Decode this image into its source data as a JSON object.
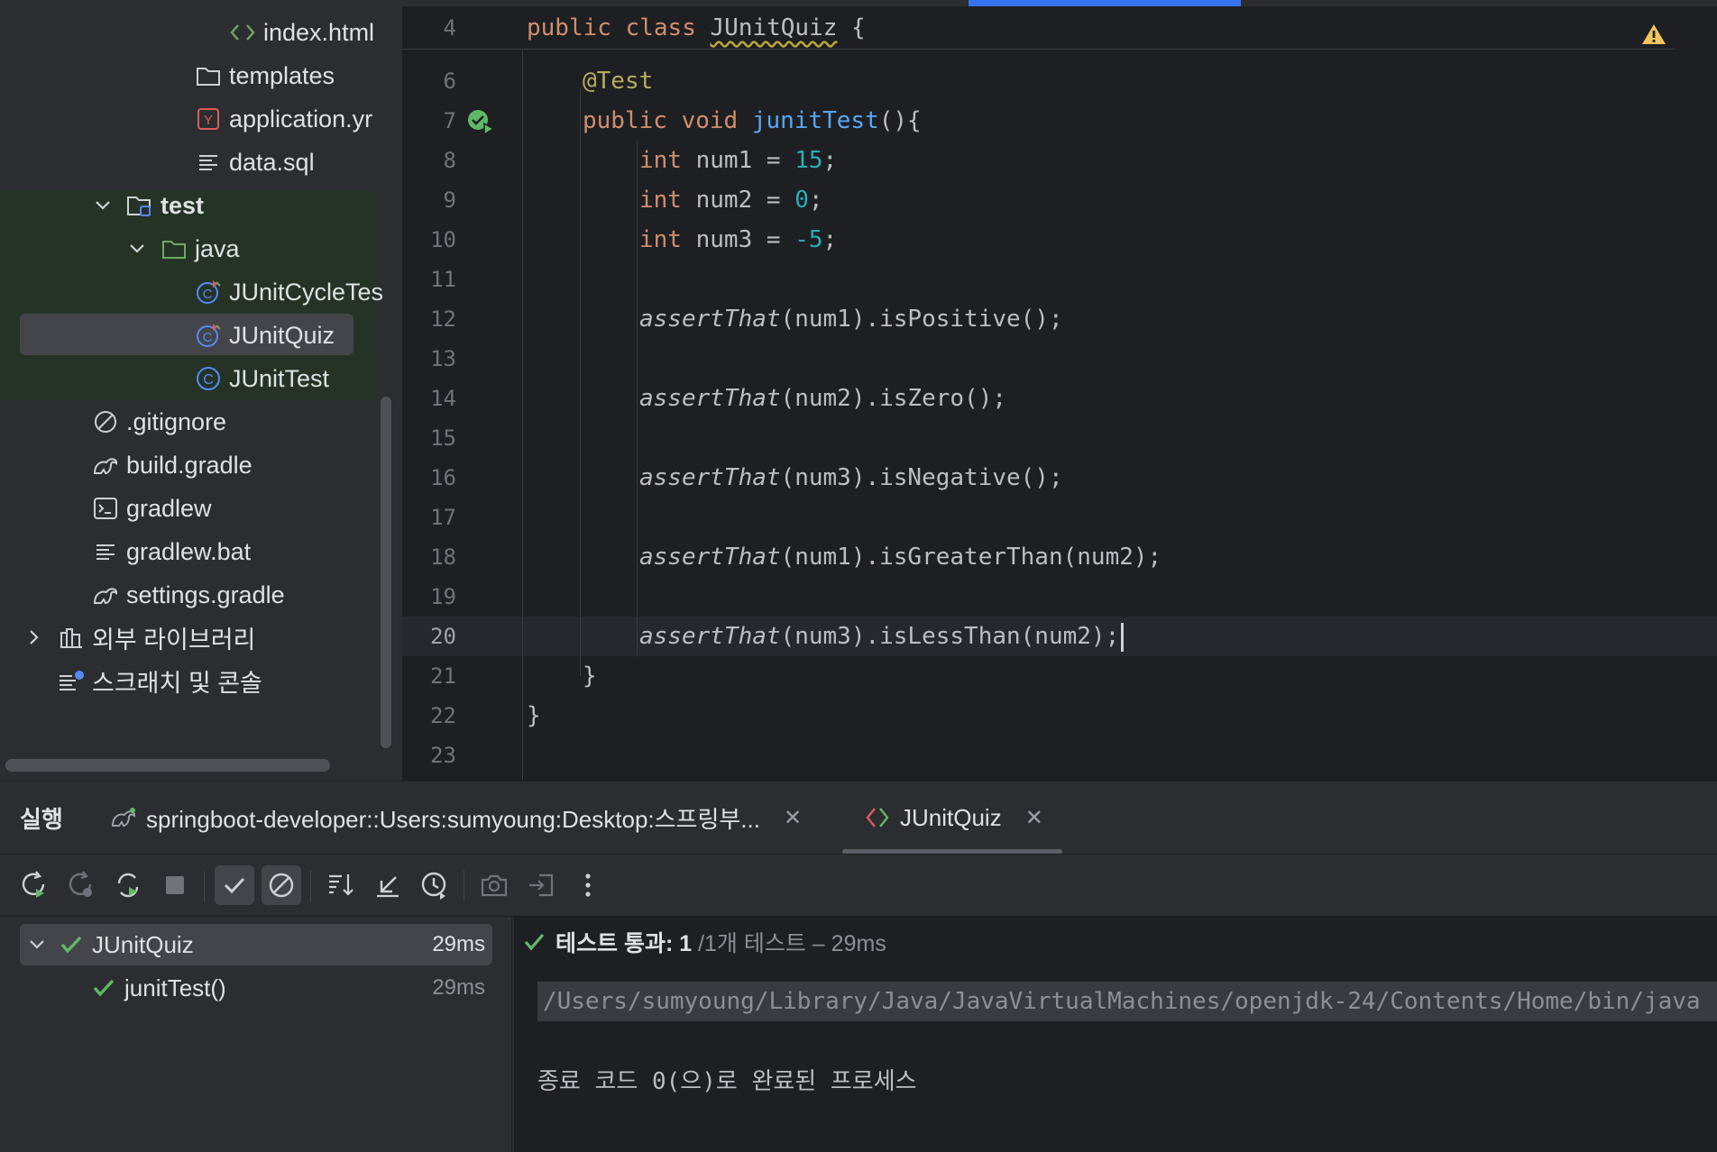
{
  "project_tree": {
    "items": [
      {
        "label": "index.html",
        "icon": "html-icon"
      },
      {
        "label": "templates",
        "icon": "folder-icon"
      },
      {
        "label": "application.yr",
        "icon": "yaml-icon"
      },
      {
        "label": "data.sql",
        "icon": "text-file-icon"
      },
      {
        "label": "test",
        "icon": "test-folder-icon"
      },
      {
        "label": "java",
        "icon": "folder-icon"
      },
      {
        "label": "JUnitCycleTes",
        "icon": "test-class-icon"
      },
      {
        "label": "JUnitQuiz",
        "icon": "test-class-icon"
      },
      {
        "label": "JUnitTest",
        "icon": "class-icon"
      },
      {
        "label": ".gitignore",
        "icon": "ignore-icon"
      },
      {
        "label": "build.gradle",
        "icon": "gradle-icon"
      },
      {
        "label": "gradlew",
        "icon": "terminal-file-icon"
      },
      {
        "label": "gradlew.bat",
        "icon": "text-file-icon"
      },
      {
        "label": "settings.gradle",
        "icon": "gradle-icon"
      },
      {
        "label": "외부 라이브러리",
        "icon": "library-icon"
      },
      {
        "label": "스크래치 및 콘솔",
        "icon": "scratch-icon"
      }
    ]
  },
  "editor": {
    "line_numbers": [
      "4",
      "6",
      "7",
      "8",
      "9",
      "10",
      "11",
      "12",
      "13",
      "14",
      "15",
      "16",
      "17",
      "18",
      "19",
      "20",
      "21",
      "22",
      "23"
    ],
    "current_line": "20",
    "sticky": {
      "kw1": "public",
      "kw2": "class",
      "class_name": "JUnitQuiz",
      "brace": " {"
    },
    "l6": {
      "annotation": "@Test"
    },
    "l7": {
      "kw1": "public",
      "kw2": "void",
      "method": "junitTest",
      "rest": "(){"
    },
    "l8": {
      "type": "int",
      "decl": " num1 = ",
      "value": "15",
      "end": ";"
    },
    "l9": {
      "type": "int",
      "decl": " num2 = ",
      "value": "0",
      "end": ";"
    },
    "l10": {
      "type": "int",
      "decl": " num3 = ",
      "value": "-5",
      "end": ";"
    },
    "assert_fn": "assertThat",
    "l12": "(num1).isPositive();",
    "l14": "(num2).isZero();",
    "l16": "(num3).isNegative();",
    "l18": "(num1).isGreaterThan(num2);",
    "l20": "(num3).isLessThan(num2);",
    "l21": "}",
    "l22": "}"
  },
  "run_panel": {
    "title": "실행",
    "tabs": [
      {
        "label": "springboot-developer::Users:sumyoung:Desktop:스프링부...",
        "icon": "gradle-icon"
      },
      {
        "label": "JUnitQuiz",
        "icon": "junit-icon"
      }
    ],
    "close_glyph": "✕",
    "tests": [
      {
        "name": "JUnitQuiz",
        "time": "29ms"
      },
      {
        "name": "junitTest()",
        "time": "29ms"
      }
    ],
    "status": {
      "bold": "테스트 통과: 1",
      "rest": " /1개 테스트 – 29ms"
    },
    "console": {
      "command": "/Users/sumyoung/Library/Java/JavaVirtualMachines/openjdk-24/Contents/Home/bin/java ...",
      "exit": "종료 코드 0(으)로 완료된 프로세스"
    }
  },
  "colors": {
    "accent": "#3574f0",
    "pass_green": "#5fb865",
    "keyword": "#cf8e6d",
    "function": "#56a8f5",
    "number": "#2aacb8",
    "annotation": "#b3ae60"
  }
}
